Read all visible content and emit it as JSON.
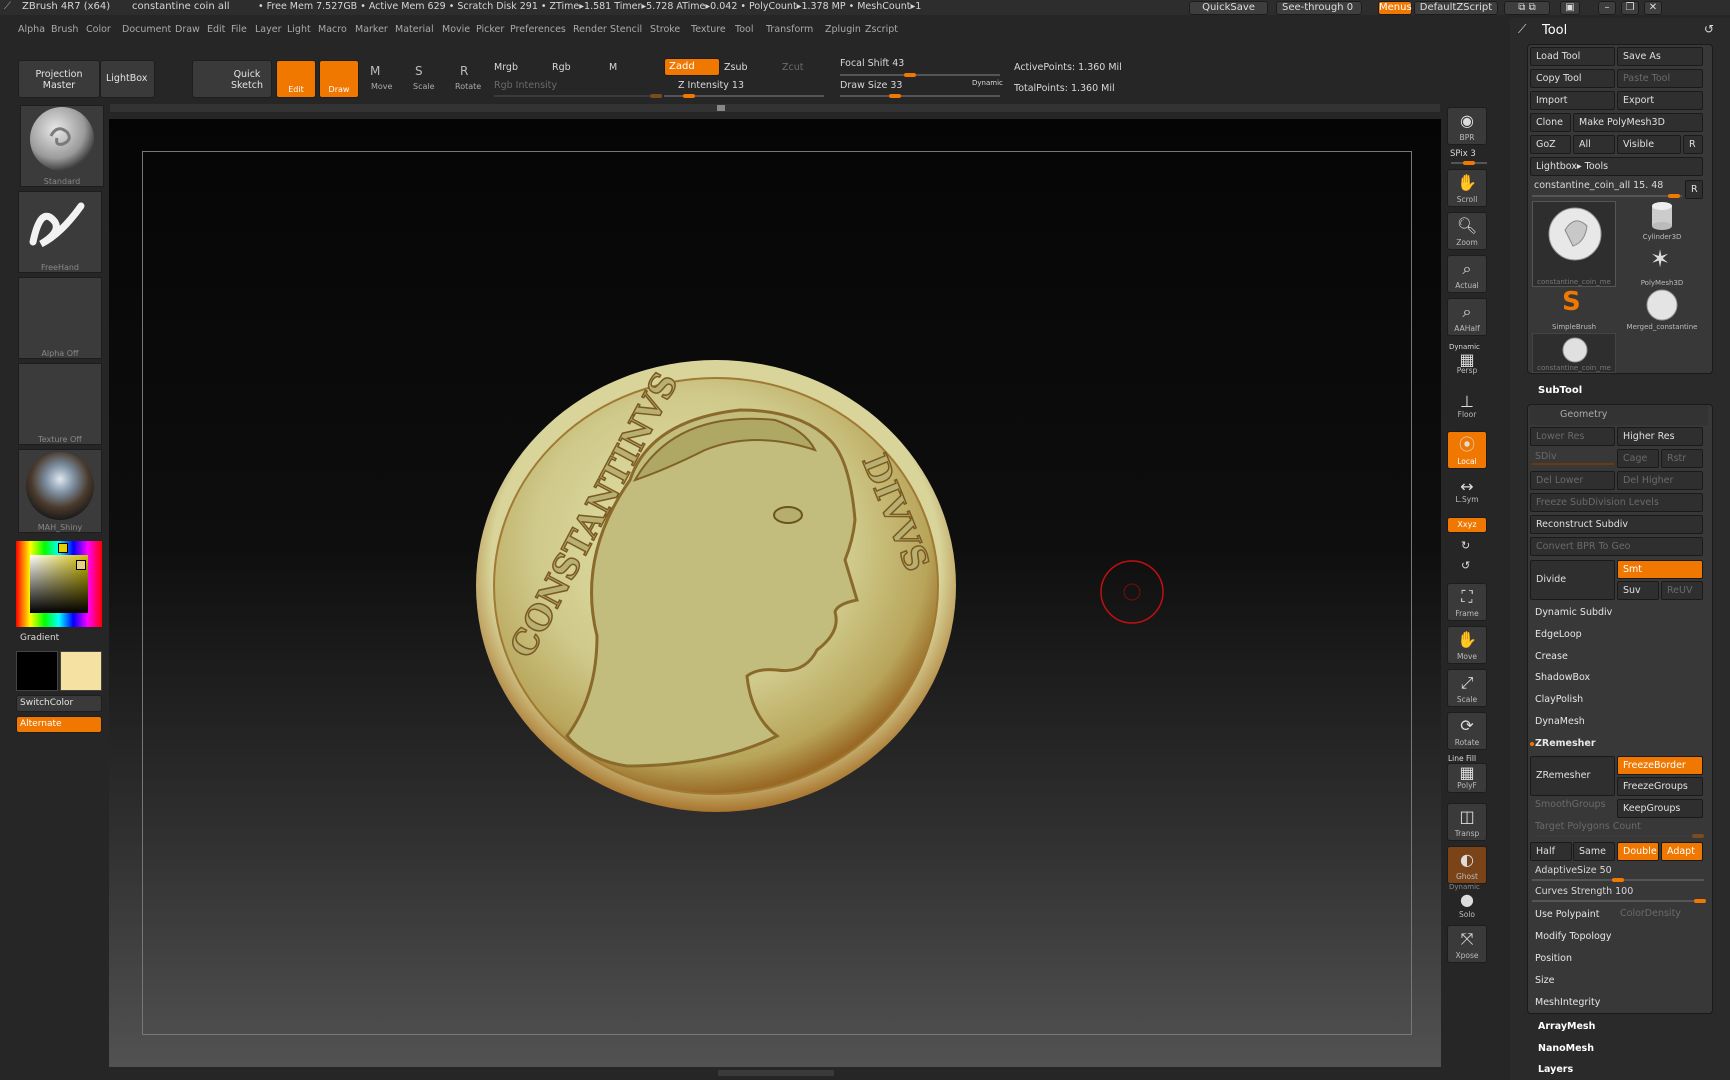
{
  "titlebar": {
    "app": "ZBrush 4R7 (x64)",
    "doc": "constantine coin all",
    "stats": "• Free Mem 7.527GB • Active Mem 629 • Scratch Disk 291 • ZTime▸1.581 Timer▸5.728 ATime▸0.042 • PolyCount▸1.378 MP • MeshCount▸1",
    "quicksave": "QuickSave",
    "seethrough": "See-through  0",
    "menus": "Menus",
    "script": "DefaultZScript"
  },
  "menubar": [
    "Alpha",
    "Brush",
    "Color",
    "Document",
    "Draw",
    "Edit",
    "File",
    "Layer",
    "Light",
    "Macro",
    "Marker",
    "Material",
    "Movie",
    "Picker",
    "Preferences",
    "Render",
    "Stencil",
    "Stroke",
    "Texture",
    "Tool",
    "Transform",
    "Zplugin",
    "Zscript"
  ],
  "shelf": {
    "projection_master": "Projection Master",
    "lightbox": "LightBox",
    "quick_sketch": "Quick Sketch",
    "edit": "Edit",
    "draw": "Draw",
    "move": "Move",
    "scale": "Scale",
    "rotate": "Rotate",
    "mrgb": "Mrgb",
    "rgb": "Rgb",
    "m": "M",
    "rgb_intensity": "Rgb Intensity",
    "zadd": "Zadd",
    "zsub": "Zsub",
    "zcut": "Zcut",
    "z_intensity": "Z Intensity 13",
    "focal_shift": "Focal Shift 43",
    "draw_size": "Draw Size 33",
    "dynamic": "Dynamic",
    "active_points": "ActivePoints: 1.360  Mil",
    "total_points": "TotalPoints: 1.360  Mil",
    "z_intensity_value": 13,
    "focal_shift_value": 43,
    "draw_size_value": 33
  },
  "leftpanel": {
    "standard": "Standard",
    "freehand": "FreeHand",
    "alpha_off": "Alpha  Off",
    "texture_off": "Texture  Off",
    "material": "MAH_Shiny",
    "gradient": "Gradient",
    "switchcolor": "SwitchColor",
    "alternate": "Alternate"
  },
  "rightstrip": {
    "bpr": "BPR",
    "spix": "SPix 3",
    "scroll": "Scroll",
    "zoom": "Zoom",
    "actual": "Actual",
    "aahalf": "AAHalf",
    "dynamic": "Dynamic",
    "persp": "Persp",
    "floor": "Floor",
    "local": "Local",
    "lsym": "L.Sym",
    "xyz": "Xxyz",
    "frame": "Frame",
    "move": "Move",
    "scale": "Scale",
    "rotate": "Rotate",
    "linefill": "Line Fill",
    "polyf": "PolyF",
    "transp": "Transp",
    "ghost": "Ghost",
    "dynamic2": "Dynamic",
    "solo": "Solo",
    "xpose": "Xpose"
  },
  "tool": {
    "title": "Tool",
    "load_tool": "Load Tool",
    "save_as": "Save As",
    "copy_tool": "Copy Tool",
    "paste_tool": "Paste Tool",
    "import": "Import",
    "export": "Export",
    "clone": "Clone",
    "make_polymesh": "Make PolyMesh3D",
    "goz": "GoZ",
    "all": "All",
    "visible": "Visible",
    "r": "R",
    "lightbox_tools": "Lightbox▸ Tools",
    "current_tool": "constantine_coin_all 15. 48",
    "tools": [
      "constantine_coin_me",
      "Cylinder3D",
      "PolyMesh3D",
      "SimpleBrush",
      "Merged_constantine",
      "constantine_coin_me"
    ],
    "subtool": "SubTool",
    "geometry": "Geometry",
    "lower_res": "Lower Res",
    "higher_res": "Higher Res",
    "sdiv": "SDiv",
    "cage": "Cage",
    "rstr": "Rstr",
    "del_lower": "Del Lower",
    "del_higher": "Del Higher",
    "freeze_subdiv": "Freeze SubDivision Levels",
    "reconstruct": "Reconstruct Subdiv",
    "convert_bpr": "Convert BPR To Geo",
    "divide": "Divide",
    "smt": "Smt",
    "suv": "Suv",
    "reuv": "ReUV",
    "dynamic_subdiv": "Dynamic Subdiv",
    "edgeloop": "EdgeLoop",
    "crease": "Crease",
    "shadowbox": "ShadowBox",
    "claypolish": "ClayPolish",
    "dynamesh": "DynaMesh",
    "zremesher_sec": "ZRemesher",
    "zremesher": "ZRemesher",
    "freezeborder": "FreezeBorder",
    "freezegroups": "FreezeGroups",
    "smoothgroups": "SmoothGroups",
    "keepgroups": "KeepGroups",
    "target_poly": "Target Polygons Count",
    "half": "Half",
    "same": "Same",
    "double": "Double",
    "adapt": "Adapt",
    "adaptive_size": "AdaptiveSize 50",
    "curves_strength": "Curves Strength 100",
    "use_polypaint": "Use Polypaint",
    "colordensity": "ColorDensity",
    "modify_topology": "Modify Topology",
    "position": "Position",
    "size": "Size",
    "meshintegrity": "MeshIntegrity",
    "arraymesh": "ArrayMesh",
    "nanomesh": "NanoMesh",
    "layers": "Layers"
  },
  "coin": {
    "left_legend": "CONSTANTINVS",
    "right_legend": "DIVVS"
  },
  "colors": {
    "accent": "#f07800",
    "panel": "#383838",
    "background": "#262626"
  }
}
